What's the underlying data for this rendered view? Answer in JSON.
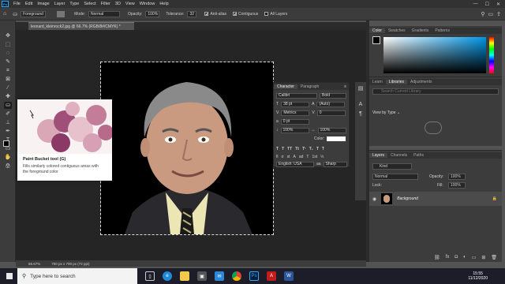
{
  "menubar": {
    "app_icon": "Ps",
    "items": [
      "File",
      "Edit",
      "Image",
      "Layer",
      "Type",
      "Select",
      "Filter",
      "3D",
      "View",
      "Window",
      "Help"
    ],
    "window_controls": [
      "—",
      "☐",
      "✕"
    ]
  },
  "options": {
    "fill_source": "Foreground",
    "mode_label": "Mode:",
    "mode_value": "Normal",
    "opacity_label": "Opacity:",
    "opacity_value": "100%",
    "tolerance_label": "Tolerance:",
    "tolerance_value": "32",
    "anti_alias": "Anti-alias",
    "contiguous": "Contiguous",
    "all_layers": "All Layers"
  },
  "document": {
    "tab_title": "leonard_kleinrock2.jpg @ 66.7% (RGB/8#/CMYK) *",
    "zoom": "66.67%",
    "size": "700 px x 700 px (72 ppi)"
  },
  "tooltip": {
    "title": "Paint Bucket tool (G)",
    "description": "Fills similarly colored contiguous areas with the foreground color"
  },
  "character": {
    "tabs": [
      "Character",
      "Paragraph"
    ],
    "font": "Calibri",
    "style": "Bold",
    "size": "38 pt",
    "leading": "(Auto)",
    "kerning": "Metrics",
    "tracking": "0",
    "kern_value": "0 pt",
    "scale_v": "100%",
    "scale_h": "100%",
    "color_label": "Color:",
    "language": "English: USA",
    "antialias": "Sharp"
  },
  "color_panel": {
    "tabs": [
      "Color",
      "Swatches",
      "Gradients",
      "Patterns"
    ]
  },
  "libraries": {
    "tabs": [
      "Learn",
      "Libraries",
      "Adjustments"
    ],
    "search_placeholder": "Search Current Library",
    "view_by": "View by Type"
  },
  "layers": {
    "tabs": [
      "Layers",
      "Channels",
      "Paths"
    ],
    "kind": "Kind",
    "blend": "Normal",
    "opacity_label": "Opacity:",
    "opacity": "100%",
    "lock_label": "Lock:",
    "fill_label": "Fill:",
    "fill": "100%",
    "items": [
      {
        "name": "Background"
      }
    ]
  },
  "taskbar": {
    "search_placeholder": "Type here to search",
    "time": "15:55",
    "date": "11/12/2020"
  },
  "colors": {
    "accent": "#31a8ff",
    "panel": "#3c3c3c",
    "canvas_bg": "#000000"
  }
}
